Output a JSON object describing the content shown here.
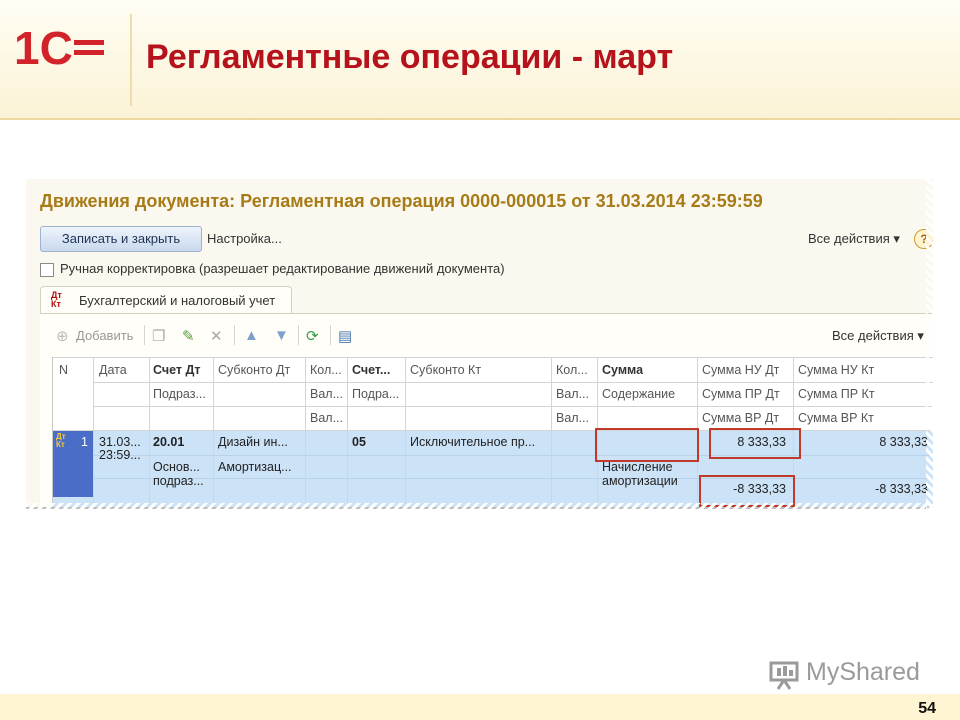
{
  "slide": {
    "logo_text": "1С",
    "title": "Регламентные операции - март",
    "page_number": "54",
    "watermark": "MyShared"
  },
  "window": {
    "title": "Движения документа: Регламентная операция 0000-000015 от 31.03.2014 23:59:59",
    "toolbar": {
      "save_close_label": "Записать и закрыть",
      "settings_label": "Настройка...",
      "all_actions_label": "Все действия ▾",
      "help_label": "?"
    },
    "manual_correction": {
      "label": "Ручная корректировка (разрешает редактирование движений документа)",
      "checked": false
    },
    "tab": {
      "icon_top": "Дт",
      "icon_bottom": "Кт",
      "label": "Бухгалтерский и налоговый учет"
    },
    "grid_toolbar": {
      "add_label": "Добавить",
      "all_actions_label": "Все действия ▾"
    },
    "columns": {
      "row1": [
        "N",
        "Дата",
        "Счет Дт",
        "Субконто Дт",
        "Кол...",
        "Счет...",
        "Субконто Кт",
        "Кол...",
        "Сумма",
        "Сумма НУ Дт",
        "Сумма НУ Кт"
      ],
      "row2": [
        "Подраз...",
        "Вал...",
        "Подра...",
        "Вал...",
        "Содержание",
        "Сумма ПР Дт",
        "Сумма ПР Кт"
      ],
      "row3": [
        "Вал...",
        "Вал...",
        "Сумма ВР Дт",
        "Сумма ВР Кт"
      ]
    },
    "row": {
      "n": "1",
      "date_line1": "31.03...",
      "date_line2": "23:59...",
      "account_dt": "20.01",
      "subconto_dt_1": "Дизайн ин...",
      "subconto_dt_2": "Амортизац...",
      "division_1": "Основ...",
      "division_2": "подраз...",
      "account_kt": "05",
      "subconto_kt": "Исключительное пр...",
      "content_line1": "Начисление",
      "content_line2": "амортизации",
      "sum_nu_dt": "8 333,33",
      "sum_nu_kt": "8 333,33",
      "sum_vr_dt": "-8 333,33",
      "sum_vr_kt": "-8 333,33"
    }
  },
  "colors": {
    "title_red": "#b5121b",
    "window_title_gold": "#a77b17",
    "selection_blue": "#cce2f7",
    "highlight_box": "#c0392b"
  }
}
